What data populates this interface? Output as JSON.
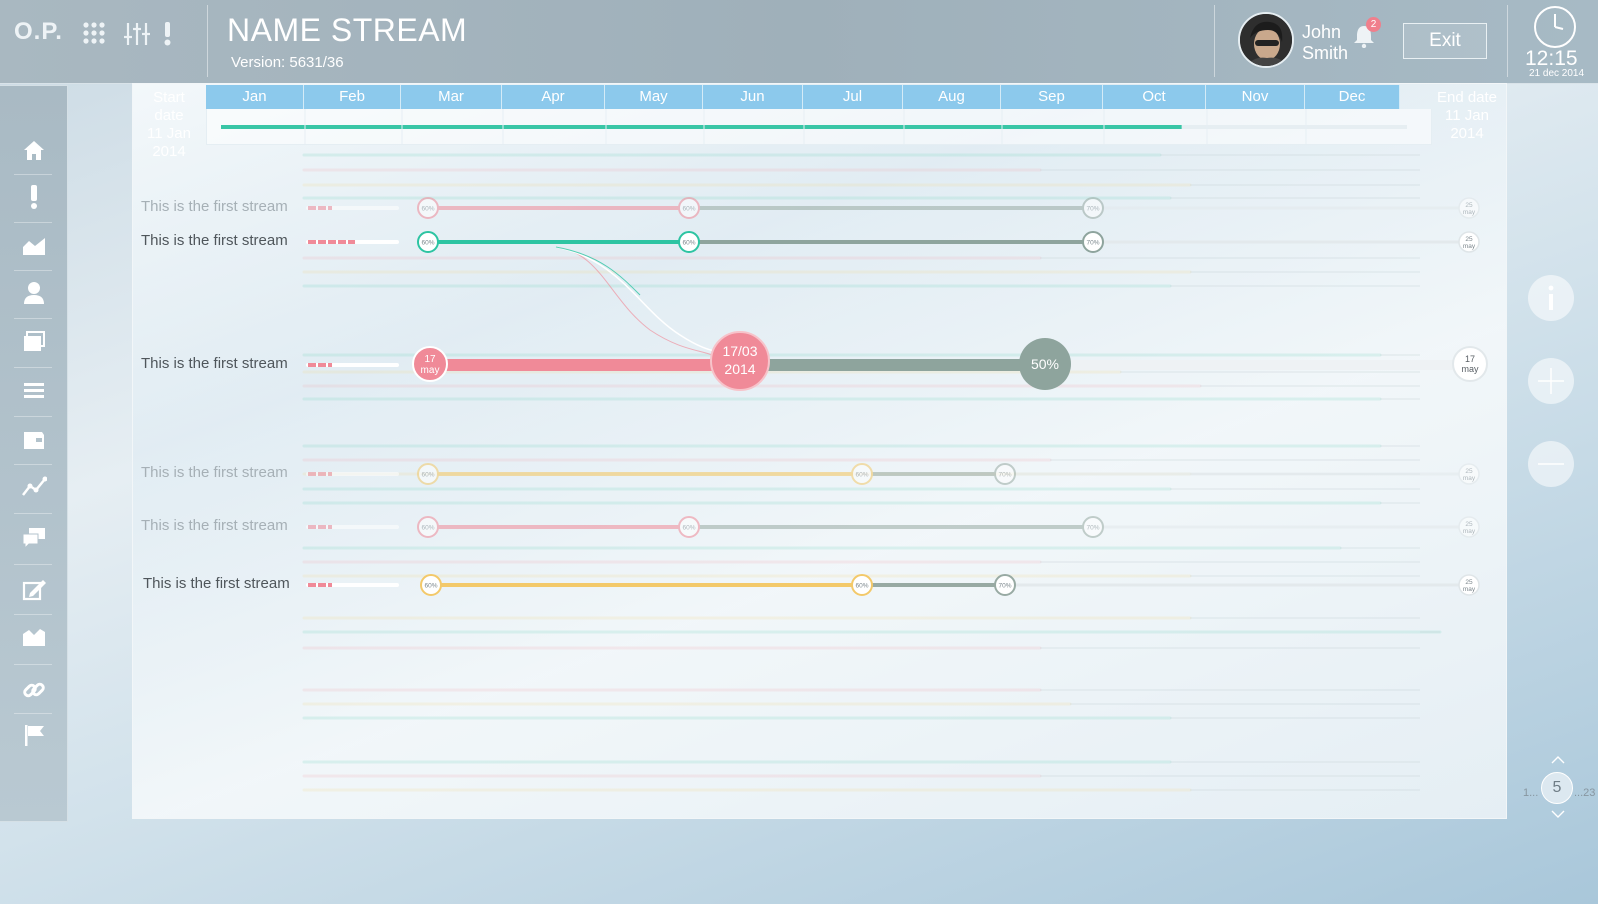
{
  "header": {
    "logo": "O.P.",
    "title": "NAME STREAM",
    "version": "Version: 5631/36",
    "user_first": "John",
    "user_last": "Smith",
    "notifications": "2",
    "exit_label": "Exit",
    "time": "12:15",
    "date": "21 dec 2014"
  },
  "sidebar": {
    "items": [
      "home-icon",
      "alert-icon",
      "area-chart-icon",
      "user-icon",
      "windows-icon",
      "list-icon",
      "folder-icon",
      "line-chart-icon",
      "chat-icon",
      "edit-icon",
      "mountain-chart-icon",
      "link-icon",
      "flag-icon"
    ]
  },
  "timeline": {
    "start_label": "Start date",
    "start_day": "11 Jan",
    "start_year": "2014",
    "end_label": "End date",
    "end_day": "11 Jan",
    "end_year": "2014",
    "months": [
      "Jan",
      "Feb",
      "Mar",
      "Apr",
      "May",
      "Jun",
      "Jul",
      "Aug",
      "Sep",
      "Oct",
      "Nov",
      "Dec"
    ],
    "progress": 0.81
  },
  "streams": [
    {
      "label": "This is the first stream",
      "muted": true,
      "color": "#f08a98",
      "m1": "60%",
      "m2": "60%",
      "m3": "70%",
      "end_day": "25",
      "end_mon": "may"
    },
    {
      "label": "This is the first stream",
      "muted": false,
      "color": "#2dc4a2",
      "m1": "60%",
      "m2": "60%",
      "m3": "70%",
      "end_day": "25",
      "end_mon": "may"
    },
    {
      "label": "This is the first stream",
      "muted": false,
      "color": "#f08a98",
      "big": true,
      "start_day": "17",
      "start_mon": "may",
      "current_date": "17/03",
      "current_year": "2014",
      "mid_pct": "50%",
      "end_day": "17",
      "end_mon": "may"
    },
    {
      "label": "This is the first stream",
      "muted": true,
      "color": "#f3c96a",
      "m1": "60%",
      "m2": "60%",
      "m3": "70%",
      "end_day": "25",
      "end_mon": "may"
    },
    {
      "label": "This is the first stream",
      "muted": true,
      "color": "#f08a98",
      "m1": "60%",
      "m2": "60%",
      "m3": "70%",
      "end_day": "25",
      "end_mon": "may"
    },
    {
      "label": "This is the first stream",
      "muted": false,
      "color": "#f3c96a",
      "m1": "60%",
      "m2": "60%",
      "m3": "70%",
      "end_day": "25",
      "end_mon": "may"
    }
  ],
  "controls": {
    "info_icon": "info-icon",
    "zoom_in_icon": "plus-icon",
    "zoom_out_icon": "minus-icon"
  },
  "pager": {
    "first": "1...",
    "current": "5",
    "last": "...23"
  }
}
